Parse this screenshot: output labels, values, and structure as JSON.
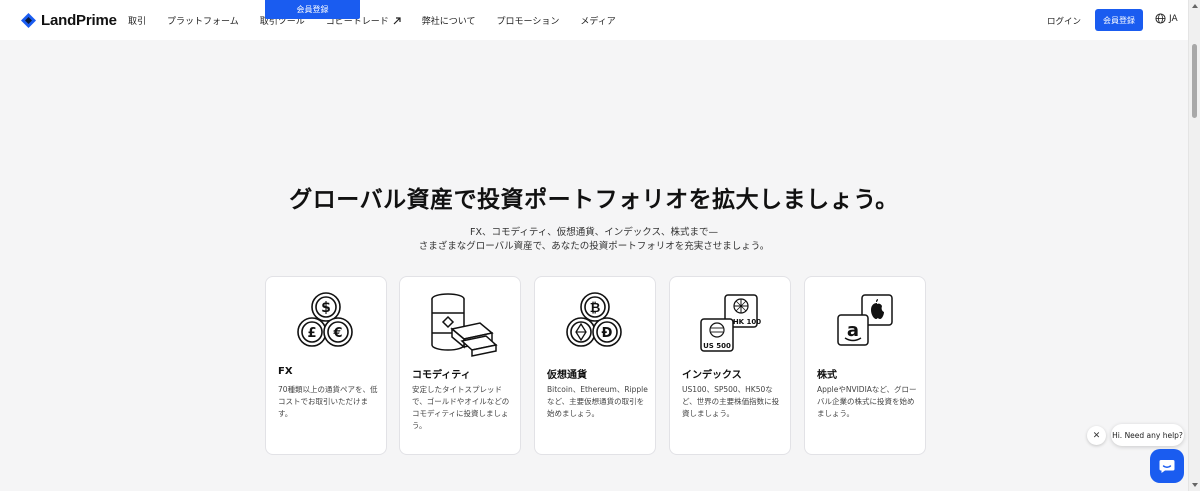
{
  "header": {
    "logo_text": "LandPrime",
    "promo_button": "会員登録",
    "nav": [
      {
        "label": "取引"
      },
      {
        "label": "プラットフォーム"
      },
      {
        "label": "取引ツール"
      },
      {
        "label": "コピートレード"
      },
      {
        "label": "弊社について"
      },
      {
        "label": "プロモーション"
      },
      {
        "label": "メディア"
      }
    ],
    "login": "ログイン",
    "signup": "会員登録",
    "language": "JA"
  },
  "hero": {
    "headline": "グローバル資産で投資ポートフォリオを拡大しましょう。",
    "sub_line1": "FX、コモディティ、仮想通貨、インデックス、株式まで—",
    "sub_line2": "さまざまなグローバル資産で、あなたの投資ポートフォリオを充実させましょう。"
  },
  "cards": [
    {
      "title": "FX",
      "desc": "70種類以上の通貨ペアを、低コストでお取引いただけます。",
      "icon": "currency-coins-icon"
    },
    {
      "title": "コモディティ",
      "desc": "安定したタイトスプレッドで、ゴールドやオイルなどのコモディティに投資しましょう。",
      "icon": "oil-barrel-gold-icon"
    },
    {
      "title": "仮想通貨",
      "desc": "Bitcoin、Ethereum、Rippleなど、主要仮想通貨の取引を始めましょう。",
      "icon": "crypto-coins-icon"
    },
    {
      "title": "インデックス",
      "desc": "US100、SP500、HK50など、世界の主要株価指数に投資しましょう。",
      "icon": "index-flags-icon",
      "badges": [
        "HK 100",
        "US 500"
      ]
    },
    {
      "title": "株式",
      "desc": "AppleやNVIDIAなど、グローバル企業の株式に投資を始めましょう。",
      "icon": "stock-logos-icon"
    }
  ],
  "chat": {
    "bubble_text": "Hi. Need any help?",
    "close_glyph": "✕"
  },
  "colors": {
    "accent": "#1a5cf0",
    "background": "#f5f5f6"
  }
}
